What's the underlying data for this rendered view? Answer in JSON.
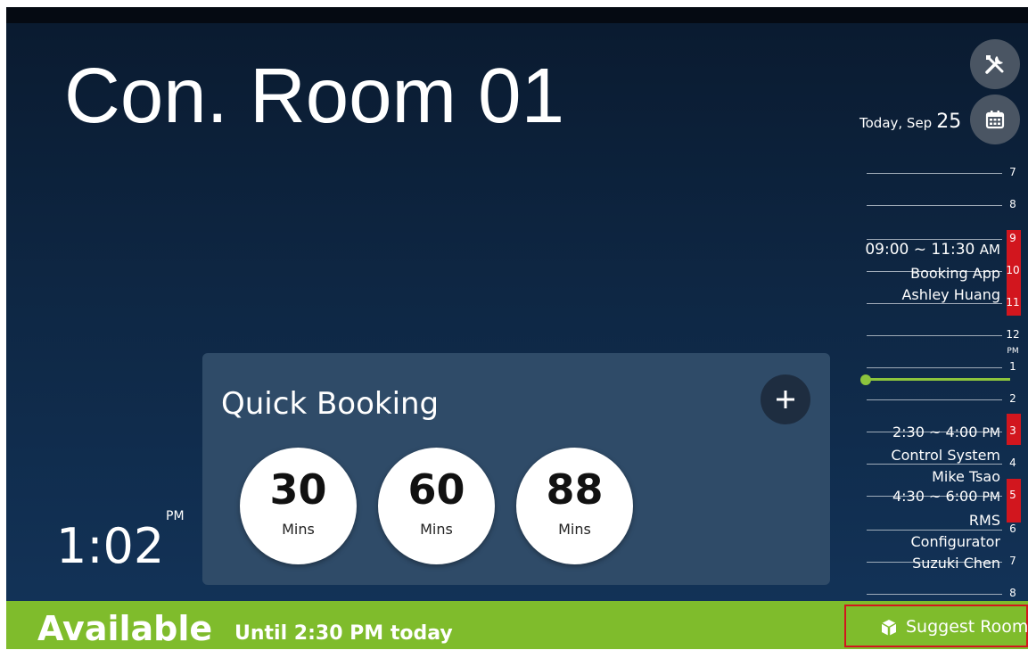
{
  "room": {
    "title": "Con. Room 01"
  },
  "header": {
    "settings_icon": "tools-icon",
    "calendar_icon": "calendar-icon",
    "date_prefix": "Today, Sep",
    "date_day": "25"
  },
  "timeline": {
    "hours": [
      "7",
      "8",
      "9",
      "10",
      "11",
      "12",
      "1",
      "2",
      "3",
      "4",
      "5",
      "6",
      "7",
      "8"
    ],
    "pm_marker": "PM",
    "current_time_color": "#8cc43d",
    "busy_color": "#d2161e",
    "events": [
      {
        "time": "09:00 ~ 11:30",
        "ampm": "AM",
        "title": "Booking App",
        "organizer": "Ashley Huang"
      },
      {
        "time": "2:30 ~ 4:00",
        "ampm": "PM",
        "title": "Control System",
        "organizer": "Mike Tsao"
      },
      {
        "time": "4:30 ~ 6:00",
        "ampm": "PM",
        "title": "RMS",
        "title2": "Configurator",
        "organizer": "Suzuki Chen"
      }
    ]
  },
  "quick_booking": {
    "title": "Quick Booking",
    "add_icon": "plus-icon",
    "durations": [
      {
        "value": "30",
        "unit": "Mins"
      },
      {
        "value": "60",
        "unit": "Mins"
      },
      {
        "value": "88",
        "unit": "Mins"
      }
    ]
  },
  "clock": {
    "time": "1:02",
    "ampm": "PM"
  },
  "status": {
    "label": "Available",
    "until": "Until 2:30 PM today",
    "color": "#7fbc2c",
    "suggest_label": "Suggest Room",
    "suggest_icon": "cube-icon"
  }
}
